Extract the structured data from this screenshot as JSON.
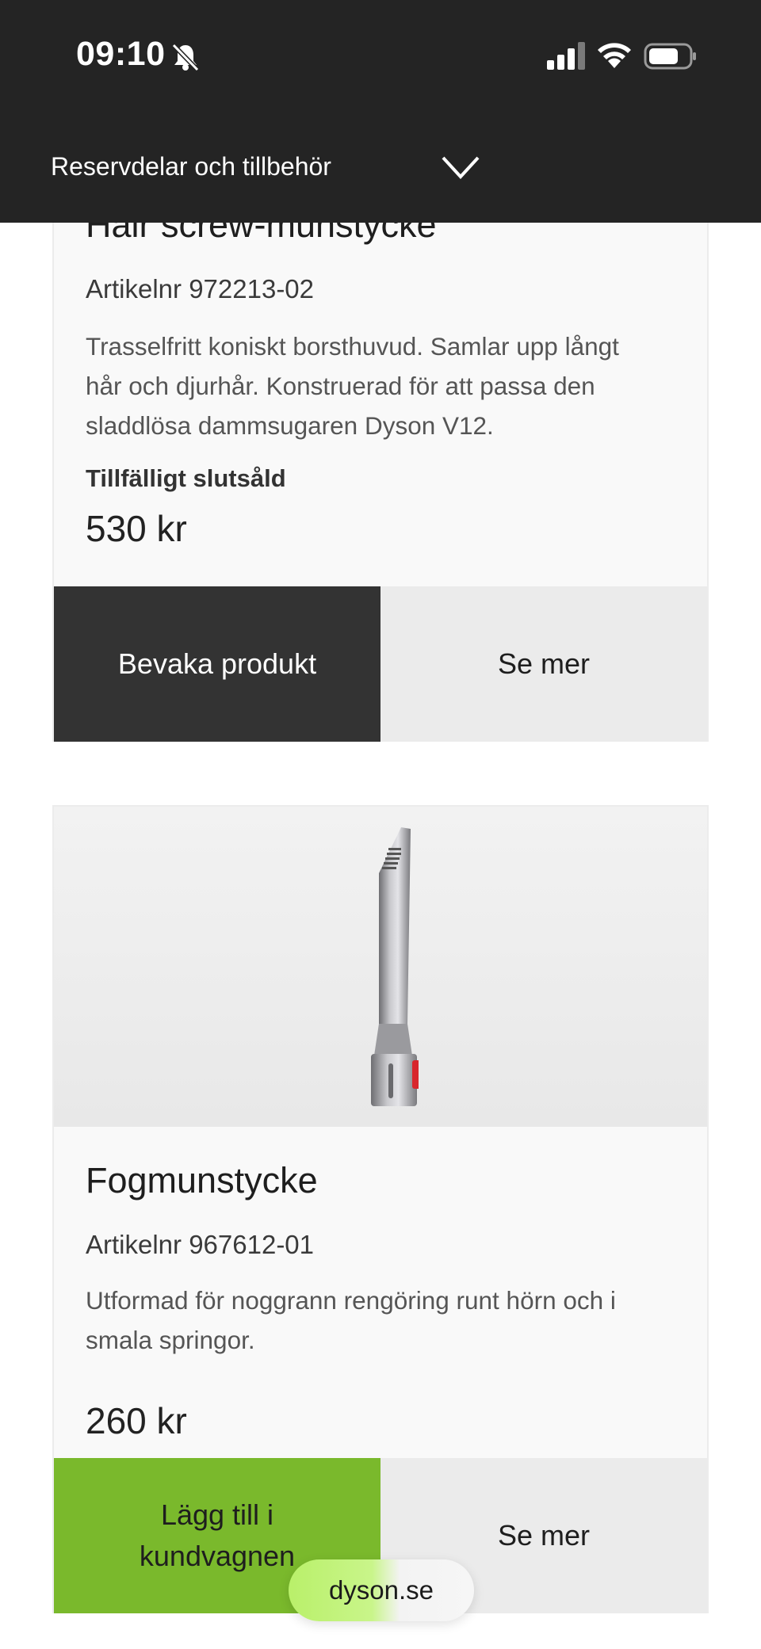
{
  "status_bar": {
    "time": "09:10",
    "icons": [
      "bell-off-icon",
      "signal-icon",
      "wifi-icon",
      "battery-icon"
    ]
  },
  "nav": {
    "label": "Reservdelar och tillbehör",
    "icon": "chevron-down-icon"
  },
  "products": [
    {
      "title": "Hair screw-munstycke",
      "sku": "Artikelnr 972213-02",
      "description_lines": [
        "Trasselfritt koniskt borsthuvud. Samlar upp långt",
        "hår och djurhår. Konstruerad för att passa den",
        "sladdlösa dammsugaren Dyson V12."
      ],
      "stock_status": "Tillfälligt slutsåld",
      "price": "530 kr",
      "primary_button": "Bevaka produkt",
      "secondary_button": "Se mer"
    },
    {
      "title": "Fogmunstycke",
      "sku": "Artikelnr 967612-01",
      "description_lines": [
        "Utformad för noggrann rengöring runt hörn och i",
        "smala springor."
      ],
      "price": "260 kr",
      "primary_button_lines": [
        "Lägg till i",
        "kundvagnen"
      ],
      "secondary_button": "Se mer"
    }
  ],
  "url_pill": "dyson.se",
  "colors": {
    "header_bg": "#242424",
    "dark_button": "#333333",
    "green_button": "#7ab92c",
    "light_button": "#ebebeb"
  }
}
